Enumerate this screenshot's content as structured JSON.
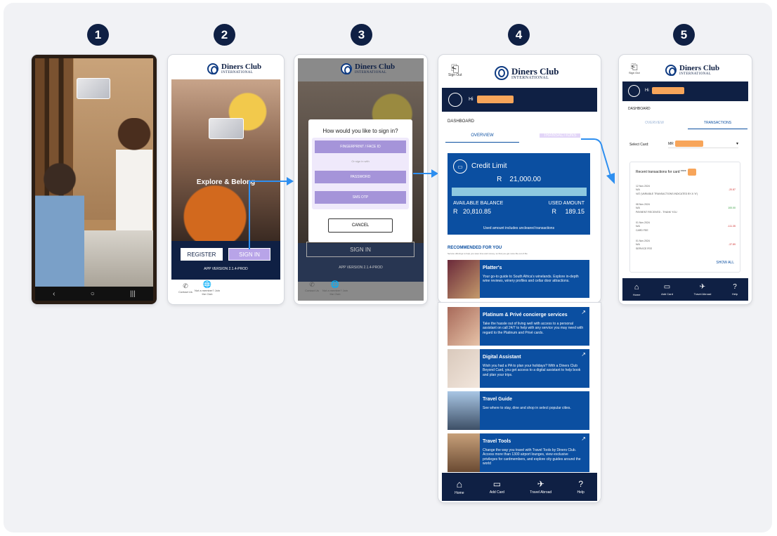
{
  "steps": [
    "1",
    "2",
    "3",
    "4",
    "5"
  ],
  "brand": {
    "name": "Diners Club",
    "sub": "INTERNATIONAL"
  },
  "screen2": {
    "tagline": "Explore & Belong",
    "register": "REGISTER",
    "sign_in": "SIGN IN",
    "version": "APP VERSION 2.1.4-PROD",
    "contact": "Contact Us",
    "member": "Not a member? Join the Club"
  },
  "screen3": {
    "question": "How would you like to sign in?",
    "opt1": "FINGERPRINT / FACE ID",
    "divider": "Or sign in with",
    "opt2": "PASSWORD",
    "opt3": "SMS OTP",
    "cancel": "CANCEL",
    "sign_in": "SIGN IN",
    "version": "APP VERSION 2.1.4-PROD",
    "contact": "Contact Us",
    "member": "Not a member? Join the Club"
  },
  "screen4": {
    "signout": "Sign Out",
    "greeting": "Hi",
    "dashboard": "DASHBOARD",
    "tab_overview": "OVERVIEW",
    "tab_transactions": "TRANSACTIONS",
    "credit_limit_label": "Credit Limit",
    "credit_limit": "R    21,000.00",
    "available_label": "AVAILABLE BALANCE",
    "available": "R   20,810.85",
    "used_label": "USED AMOUNT",
    "used": "R     189.15",
    "note": "Used amount includes uncleared transactions",
    "recommended": "RECOMMENDED FOR YOU",
    "recommended_sub": "Service offerings to help you save time and money, so that you get more life out of life.",
    "recs": [
      {
        "title": "Platter's",
        "desc": "Your go-to guide to South Africa's winelands. Explore in-depth wine reviews, winery profiles and cellar door attractions."
      },
      {
        "title": "Platinum & Privé concierge services",
        "desc": "Take the hassle out of living well with access to a personal assistant on call 24/7 to help with any service you may need with regard to the Platinum and Privé cards."
      },
      {
        "title": "Digital Assistant",
        "desc": "Wish you had a PA to plan your holidays? With a Diners Club Beyond Card, you get access to a digital assistant to help book and plan your trips."
      },
      {
        "title": "Travel Guide",
        "desc": "See where to stay, dine and shop in select popular cities."
      },
      {
        "title": "Travel Tools",
        "desc": "Change the way you travel with Travel Tools by Diners Club. Access more than 1300 airport lounges, view exclusive privileges for cardmembers, and explore city guides around the world"
      }
    ],
    "nav": [
      "Home",
      "Add Card",
      "Travel Abroad",
      "Help"
    ]
  },
  "screen5": {
    "signout": "Sign Out",
    "greeting": "Hi",
    "dashboard": "DASHBOARD",
    "tab_overview": "OVERVIEW",
    "tab_transactions": "TRANSACTIONS",
    "select_label": "Select Card:",
    "select_value": "MR",
    "recent": "Recent transactions for card ****",
    "transactions": [
      {
        "date": "12 Nov 2024",
        "type": "N/A",
        "desc": "VAT (VARIABLE TRANSACTIONS INDICATED BY A \"#\")",
        "amount": "-20.87",
        "color": "#d0302f"
      },
      {
        "date": "08 Nov 2024",
        "type": "N/A",
        "desc": "PAYMENT RECEIVED - THANK YOU",
        "amount": "100.00",
        "color": "#2f9a3a"
      },
      {
        "date": "01 Nov 2024",
        "type": "N/A",
        "desc": "CARD FEE",
        "amount": "-111.35",
        "color": "#d0302f"
      },
      {
        "date": "01 Nov 2024",
        "type": "N/A",
        "desc": "SERVICE FEE",
        "amount": "-37.89",
        "color": "#d0302f"
      }
    ],
    "show_all": "SHOW ALL",
    "nav": [
      "Home",
      "Add Card",
      "Travel Abroad",
      "Help"
    ]
  },
  "colors": {
    "navy": "#0f2044",
    "blue": "#0b4fa1",
    "arrow": "#2e8ff0",
    "highlight": "#b8a4e8",
    "mask": "#f7a55a"
  }
}
